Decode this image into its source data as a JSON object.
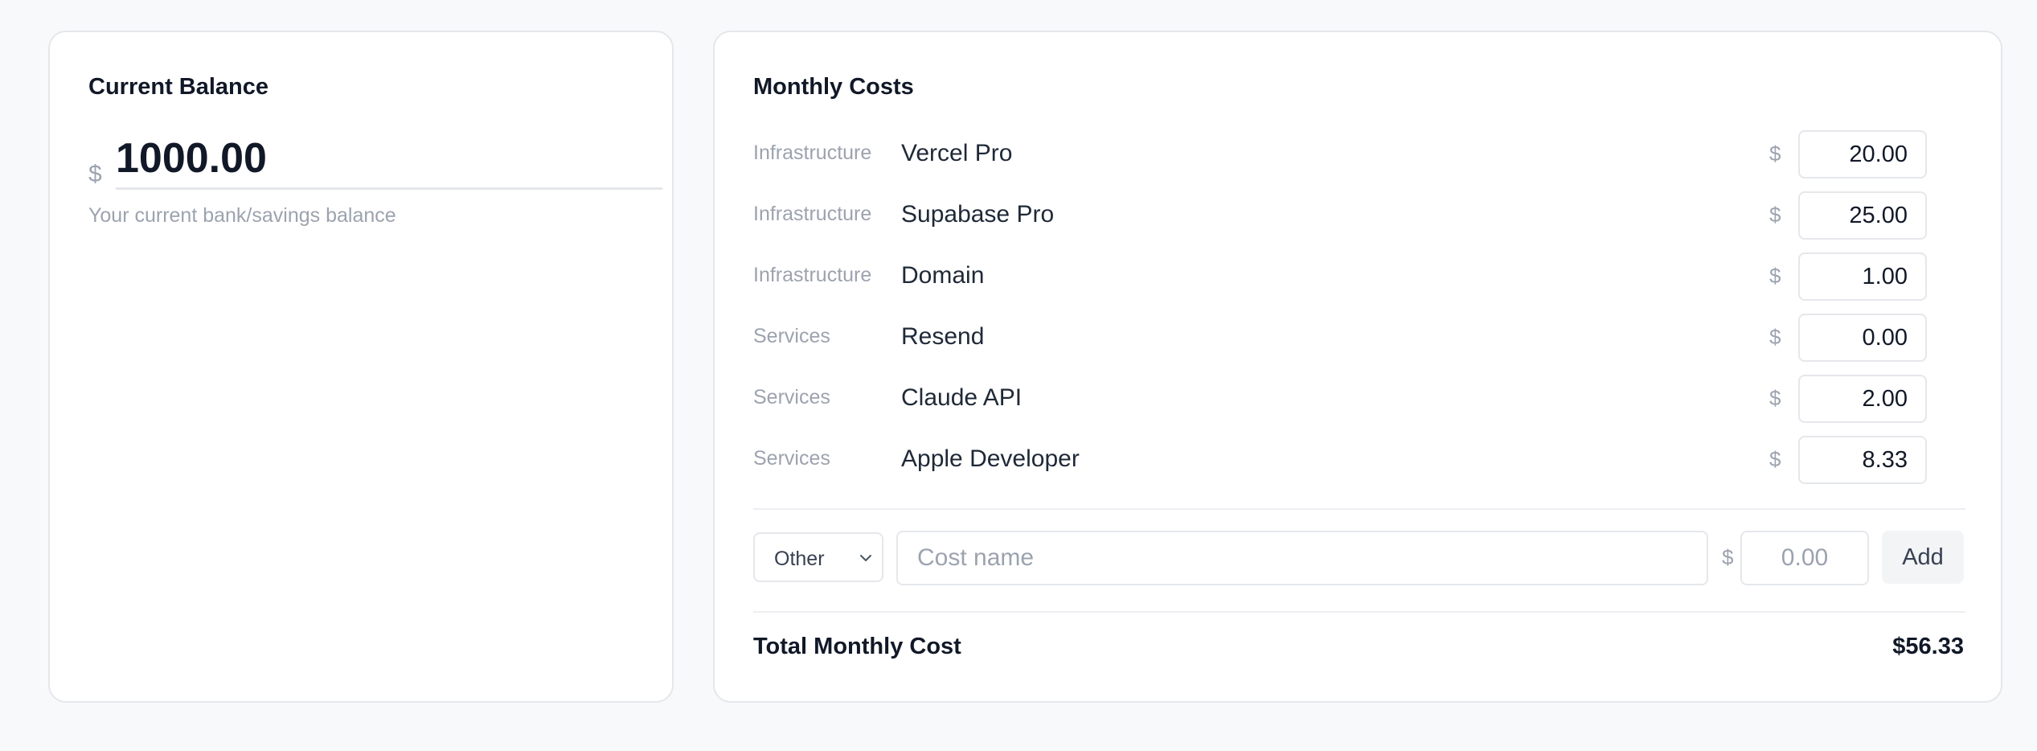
{
  "balance": {
    "title": "Current Balance",
    "currency": "$",
    "value": "1000.00",
    "help_text": "Your current bank/savings balance"
  },
  "costs": {
    "title": "Monthly Costs",
    "currency": "$",
    "items": [
      {
        "category": "Infrastructure",
        "name": "Vercel Pro",
        "amount": "20.00"
      },
      {
        "category": "Infrastructure",
        "name": "Supabase Pro",
        "amount": "25.00"
      },
      {
        "category": "Infrastructure",
        "name": "Domain",
        "amount": "1.00"
      },
      {
        "category": "Services",
        "name": "Resend",
        "amount": "0.00"
      },
      {
        "category": "Services",
        "name": "Claude API",
        "amount": "2.00"
      },
      {
        "category": "Services",
        "name": "Apple Developer",
        "amount": "8.33"
      }
    ],
    "new_cost": {
      "category_selected": "Other",
      "name_placeholder": "Cost name",
      "amount_placeholder": "0.00",
      "add_label": "Add"
    },
    "total": {
      "label": "Total Monthly Cost",
      "value": "$56.33"
    }
  }
}
